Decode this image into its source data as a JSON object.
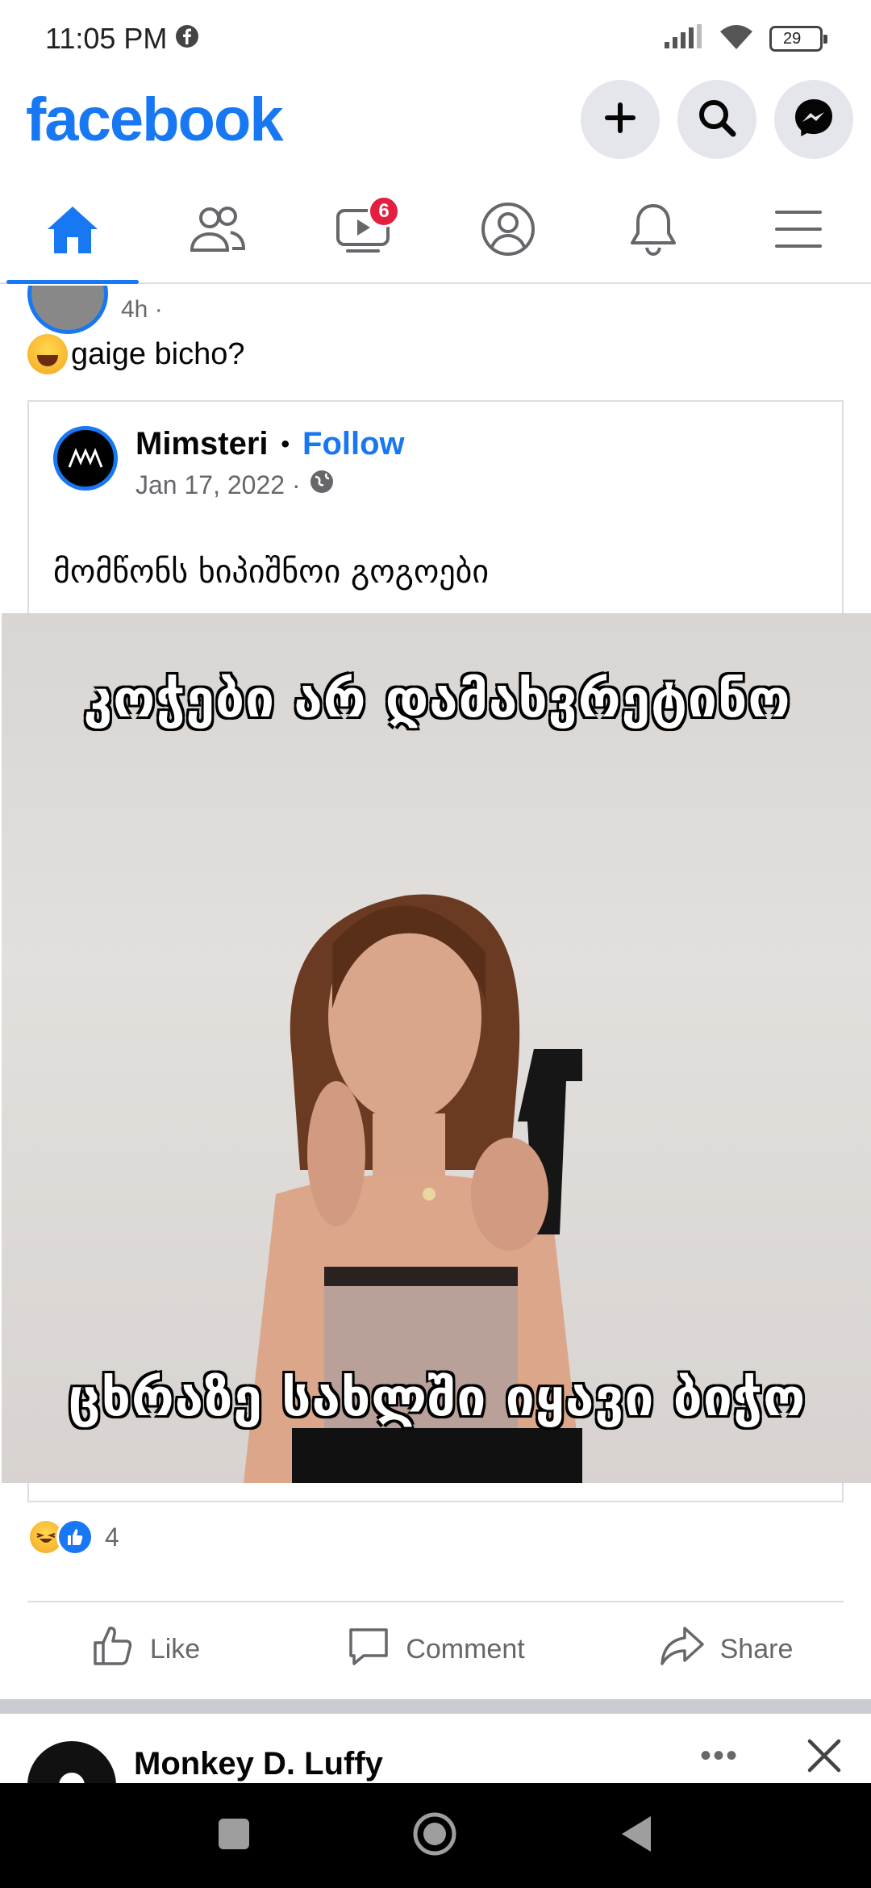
{
  "status_bar": {
    "time": "11:05 PM",
    "battery": "29"
  },
  "header": {
    "logo": "facebook",
    "icons": [
      "plus-icon",
      "search-icon",
      "messenger-icon"
    ]
  },
  "tabs": [
    {
      "name": "home",
      "icon": "home-icon",
      "active": true
    },
    {
      "name": "friends",
      "icon": "friends-icon"
    },
    {
      "name": "watch",
      "icon": "video-icon",
      "badge": "6"
    },
    {
      "name": "profile",
      "icon": "profile-icon"
    },
    {
      "name": "notifications",
      "icon": "bell-icon"
    },
    {
      "name": "menu",
      "icon": "hamburger-icon"
    }
  ],
  "post": {
    "partial_meta": "4h ·",
    "text": "gaige bicho?",
    "shared": {
      "page_name": "Mimsteri",
      "follow_label": "Follow",
      "date": "Jan 17, 2022 ·",
      "caption": "მომწონს ხიპიშნოი გოგოები",
      "meme_top_text": "კოჭები არ დამახვრეტინო",
      "meme_bottom_text": "ცხრაზე სახლში იყავი ბიჭო"
    },
    "reaction_count": "4",
    "actions": {
      "like": "Like",
      "comment": "Comment",
      "share": "Share"
    }
  },
  "next_post": {
    "author": "Monkey D. Luffy",
    "more": "•••"
  },
  "colors": {
    "brand": "#1877f2",
    "badge": "#e41e3f"
  }
}
